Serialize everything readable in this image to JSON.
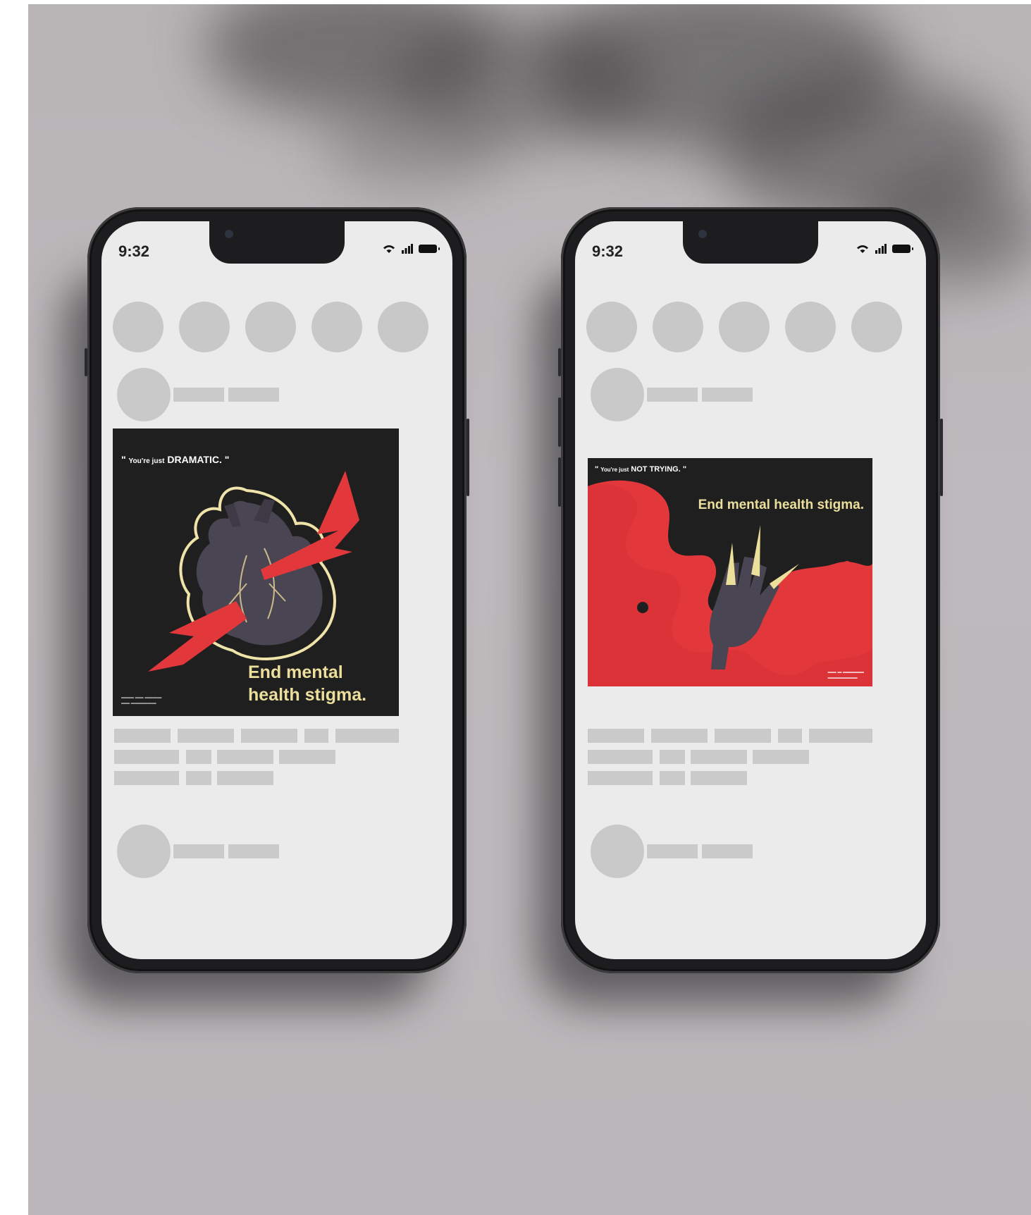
{
  "phones": [
    {
      "time": "9:32",
      "post": {
        "quote_prefix": "You're just",
        "quote_keyword": "DRAMATIC.",
        "headline_line1": "End mental",
        "headline_line2": "health stigma.",
        "illustration": "heart-icon"
      }
    },
    {
      "time": "9:32",
      "post": {
        "quote_prefix": "You're just",
        "quote_keyword": "NOT TRYING.",
        "headline": "End mental health stigma.",
        "illustration": "raised-hand-icon"
      }
    }
  ],
  "colors": {
    "background": "#bab6b9",
    "phone_frame": "#1d1d1f",
    "screen": "#ebebeb",
    "placeholder": "#c9c9c9",
    "poster_dark": "#1f1f1f",
    "poster_red": "#e2383b",
    "poster_cream": "#ecdf9c"
  }
}
